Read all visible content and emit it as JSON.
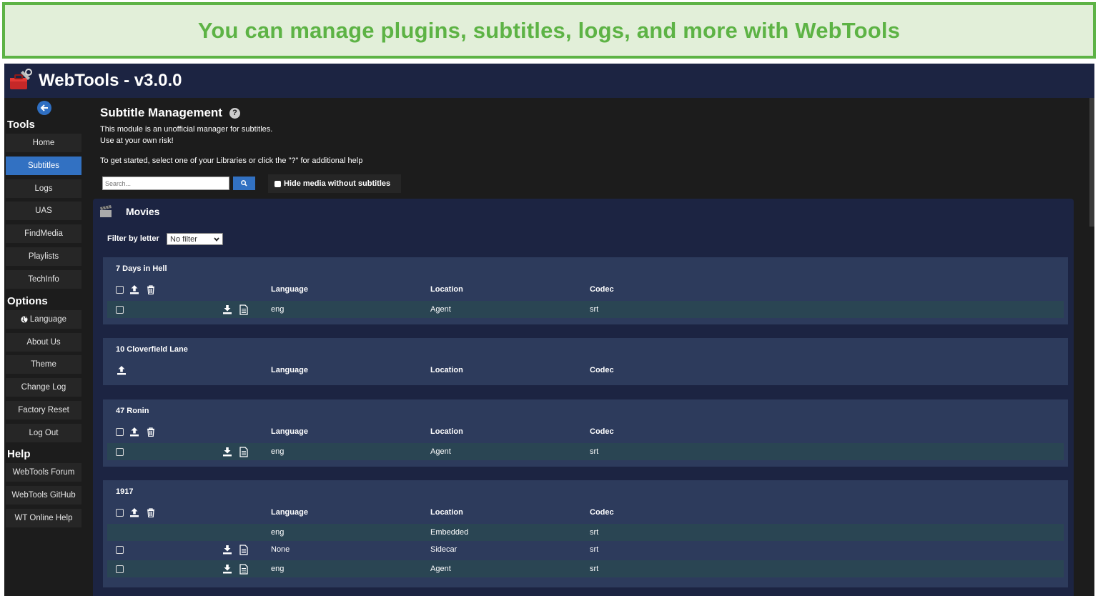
{
  "banner": {
    "text": "You can manage plugins, subtitles, logs, and more with WebTools"
  },
  "app": {
    "title": "WebTools - v3.0.0"
  },
  "sidebar": {
    "tools_heading": "Tools",
    "tools": [
      {
        "label": "Home",
        "active": false
      },
      {
        "label": "Subtitles",
        "active": true
      },
      {
        "label": "Logs",
        "active": false
      },
      {
        "label": "UAS",
        "active": false
      },
      {
        "label": "FindMedia",
        "active": false
      },
      {
        "label": "Playlists",
        "active": false
      },
      {
        "label": "TechInfo",
        "active": false
      }
    ],
    "options_heading": "Options",
    "options": [
      {
        "label": "Language"
      },
      {
        "label": "About Us"
      },
      {
        "label": "Theme"
      },
      {
        "label": "Change Log"
      },
      {
        "label": "Factory Reset"
      },
      {
        "label": "Log Out"
      }
    ],
    "help_heading": "Help",
    "help": [
      {
        "label": "WebTools Forum"
      },
      {
        "label": "WebTools GitHub"
      },
      {
        "label": "WT Online Help"
      }
    ]
  },
  "main": {
    "title": "Subtitle Management",
    "desc1": "This module is an unofficial manager for subtitles.",
    "desc2": "Use at your own risk!",
    "desc3": "To get started, select one of your Libraries or click the \"?\" for additional help",
    "search_placeholder": "Search...",
    "hide_label": "Hide media without subtitles",
    "section_title": "Movies",
    "filter_label": "Filter by letter",
    "filter_value": "No filter"
  },
  "columns": {
    "language": "Language",
    "location": "Location",
    "codec": "Codec"
  },
  "movies": [
    {
      "title": "7 Days in Hell",
      "rows": [
        {
          "language": "eng",
          "location": "Agent",
          "codec": "srt"
        }
      ]
    },
    {
      "title": "10 Cloverfield Lane",
      "rows": []
    },
    {
      "title": "47 Ronin",
      "rows": [
        {
          "language": "eng",
          "location": "Agent",
          "codec": "srt"
        }
      ]
    },
    {
      "title": "1917",
      "rows": [
        {
          "language": "eng",
          "location": "Embedded",
          "codec": "srt"
        },
        {
          "language": "None",
          "location": "Sidecar",
          "codec": "srt"
        },
        {
          "language": "eng",
          "location": "Agent",
          "codec": "srt"
        }
      ]
    }
  ],
  "colors": {
    "banner_green": "#5db345",
    "banner_bg": "#e2efd9",
    "nav_bg": "#1c2442",
    "accent": "#3271c2"
  }
}
